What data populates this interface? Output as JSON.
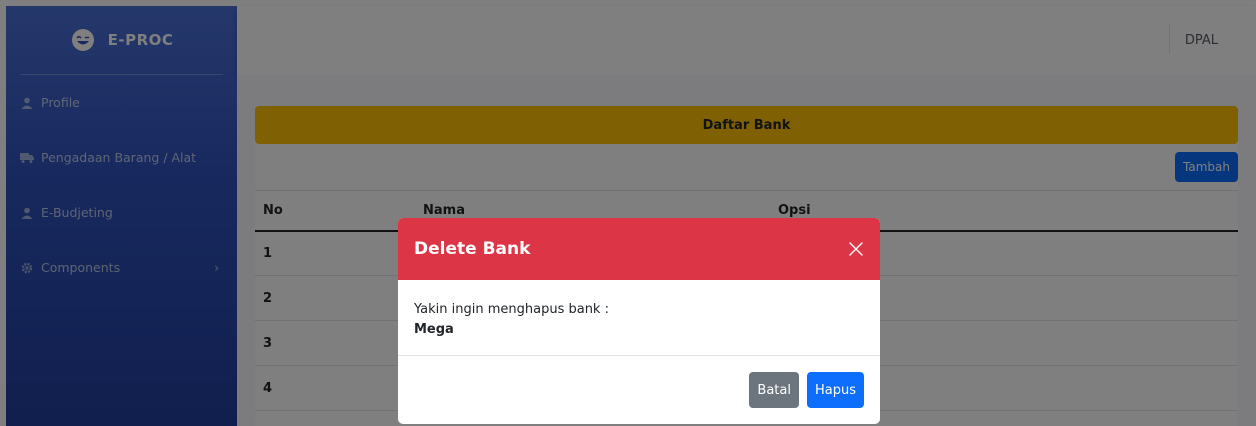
{
  "brand": {
    "name": "E-PROC",
    "icon": "laugh-wink-icon"
  },
  "sidebar": {
    "items": [
      {
        "label": "Profile",
        "icon": "user-icon"
      },
      {
        "label": "Pengadaan Barang / Alat",
        "icon": "truck-icon"
      },
      {
        "label": "E-Budjeting",
        "icon": "user-icon"
      },
      {
        "label": "Components",
        "icon": "cog-icon",
        "has_submenu": true
      }
    ]
  },
  "topbar": {
    "user": "DPAL"
  },
  "card": {
    "title": "Daftar Bank",
    "add_button": "Tambah",
    "table": {
      "headers": [
        "No",
        "Nama",
        "Opsi"
      ],
      "rows": [
        [
          "1",
          "",
          ""
        ],
        [
          "2",
          "",
          ""
        ],
        [
          "3",
          "",
          ""
        ],
        [
          "4",
          "",
          ""
        ]
      ]
    }
  },
  "modal": {
    "title": "Delete Bank",
    "message": "Yakin ingin menghapus bank :",
    "bank_name": "Mega",
    "cancel_label": "Batal",
    "confirm_label": "Hapus"
  },
  "colors": {
    "sidebar": "#2f52bd",
    "card_header": "#ffc107",
    "modal_header": "#dc3545",
    "primary": "#0d6efd",
    "secondary": "#6c757d"
  }
}
